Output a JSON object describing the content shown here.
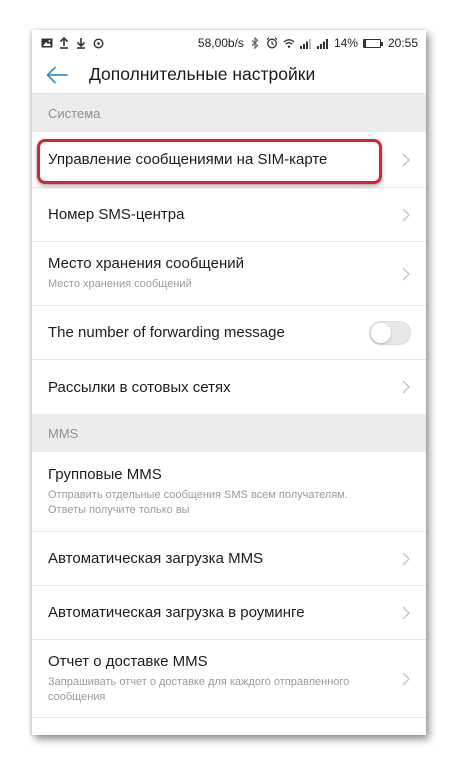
{
  "status_bar": {
    "speed": "58,00b/s",
    "battery_percent": "14%",
    "battery_level": 0.14,
    "time": "20:55",
    "icons": [
      "image-icon",
      "upload-icon",
      "download-icon",
      "circle-icon",
      "bluetooth-icon",
      "alarm-icon",
      "wifi-icon",
      "signal-icon",
      "signal-icon",
      "battery-icon"
    ]
  },
  "header": {
    "back_icon": "arrow-left-icon",
    "title": "Дополнительные настройки",
    "accent_color": "#3a8fd9"
  },
  "sections": [
    {
      "title": "Система",
      "items": [
        {
          "title": "Управление сообщениями на SIM-карте",
          "control": "chevron",
          "highlighted": true
        },
        {
          "title": "Номер SMS-центра",
          "control": "chevron"
        },
        {
          "title": "Место хранения сообщений",
          "subtitle": "Место хранения сообщений",
          "control": "chevron"
        },
        {
          "title": "The number of forwarding message",
          "control": "toggle",
          "toggle_on": false
        },
        {
          "title": "Рассылки в сотовых сетях",
          "control": "chevron"
        }
      ]
    },
    {
      "title": "MMS",
      "items": [
        {
          "title": "Групповые MMS",
          "subtitle": "Отправить отдельные сообщения SMS всем получателям. Ответы получите только вы",
          "control": "none"
        },
        {
          "title": "Автоматическая загрузка MMS",
          "control": "chevron"
        },
        {
          "title": "Автоматическая загрузка в роуминге",
          "control": "chevron"
        },
        {
          "title": "Отчет о доставке MMS",
          "subtitle": "Запрашивать отчет о доставке для каждого отправленного сообщения",
          "control": "chevron"
        }
      ]
    }
  ],
  "highlight_color": "#d0262f"
}
